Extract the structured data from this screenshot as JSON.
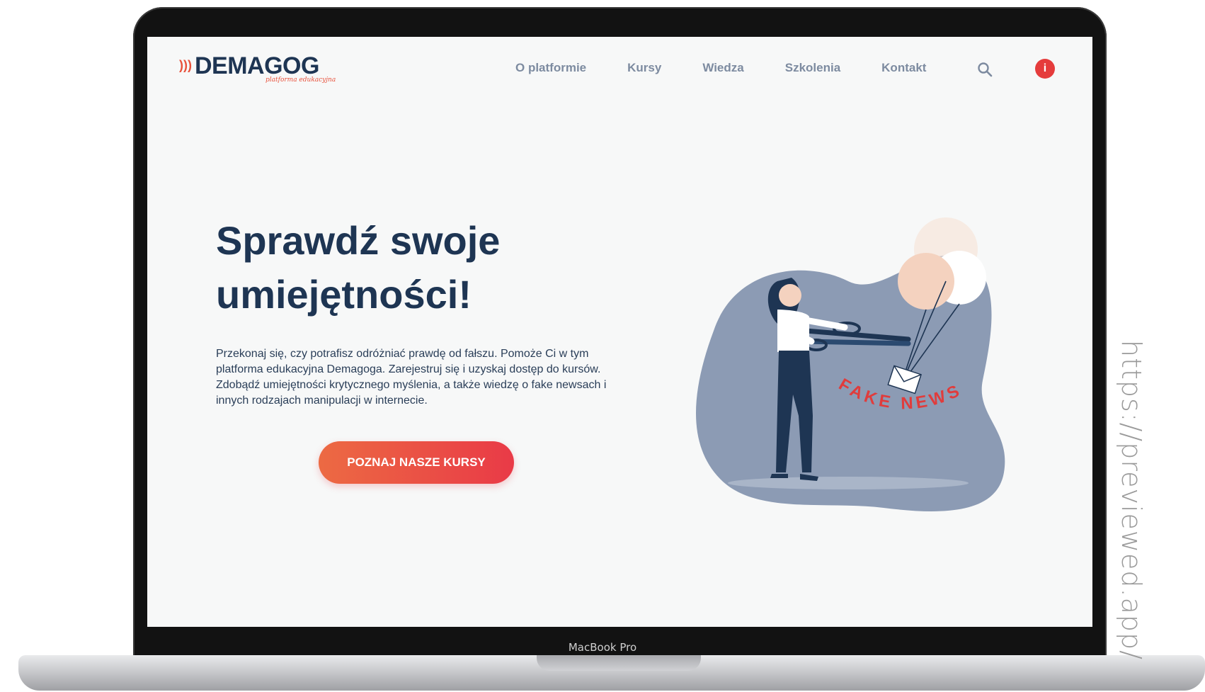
{
  "watermark": "https://previewed.app/",
  "device_label": "MacBook Pro",
  "site": {
    "logo": {
      "wordmark": "DEMAGOG",
      "tagline": "platforma edukacyjna"
    },
    "nav": {
      "items": [
        "O platformie",
        "Kursy",
        "Wiedza",
        "Szkolenia",
        "Kontakt"
      ],
      "search_icon": "search-icon",
      "info_icon": "info-icon"
    },
    "hero": {
      "title": "Sprawdź swoje umiejętności!",
      "description": "Przekonaj się, czy potrafisz odróżniać prawdę od fałszu. Pomoże Ci w tym platforma edukacyjna Demagoga. Zarejestruj się i uzyskaj dostęp do kursów. Zdobądź umiejętności krytycznego myślenia, a także wiedzę o fake newsach i innych rodzajach manipulacji w internecie.",
      "cta_label": "POZNAJ NASZE KURSY"
    },
    "illustration": {
      "caption": "FAKE NEWS"
    }
  },
  "colors": {
    "brand_navy": "#1e3553",
    "brand_red": "#e8513b",
    "cta_start": "#ec6a43",
    "cta_end": "#e93a47",
    "nav_text": "#7d8ba0",
    "blob": "#8c9bb4"
  }
}
